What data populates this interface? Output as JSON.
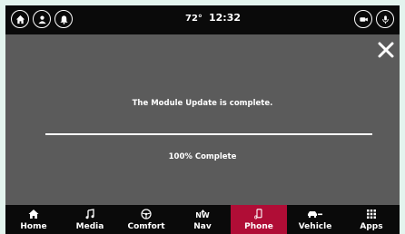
{
  "status_bar": {
    "temperature": "72°",
    "time": "12:32"
  },
  "update": {
    "message": "The Module Update is complete.",
    "progress_label": "100% Complete",
    "progress_fraction": 1.0
  },
  "nav": {
    "items": [
      {
        "label": "Home",
        "icon": "home-icon"
      },
      {
        "label": "Media",
        "icon": "music-note-icon"
      },
      {
        "label": "Comfort",
        "icon": "steering-wheel-icon"
      },
      {
        "label": "Nav",
        "icon": "compass-icon",
        "compass": "NW"
      },
      {
        "label": "Phone",
        "icon": "phone-icon",
        "active": true
      },
      {
        "label": "Vehicle",
        "icon": "car-icon"
      },
      {
        "label": "Apps",
        "icon": "grid-icon"
      }
    ]
  },
  "colors": {
    "active_tab": "#b00d36",
    "background": "#5b5b5b",
    "bars": "#0a0a0a"
  }
}
